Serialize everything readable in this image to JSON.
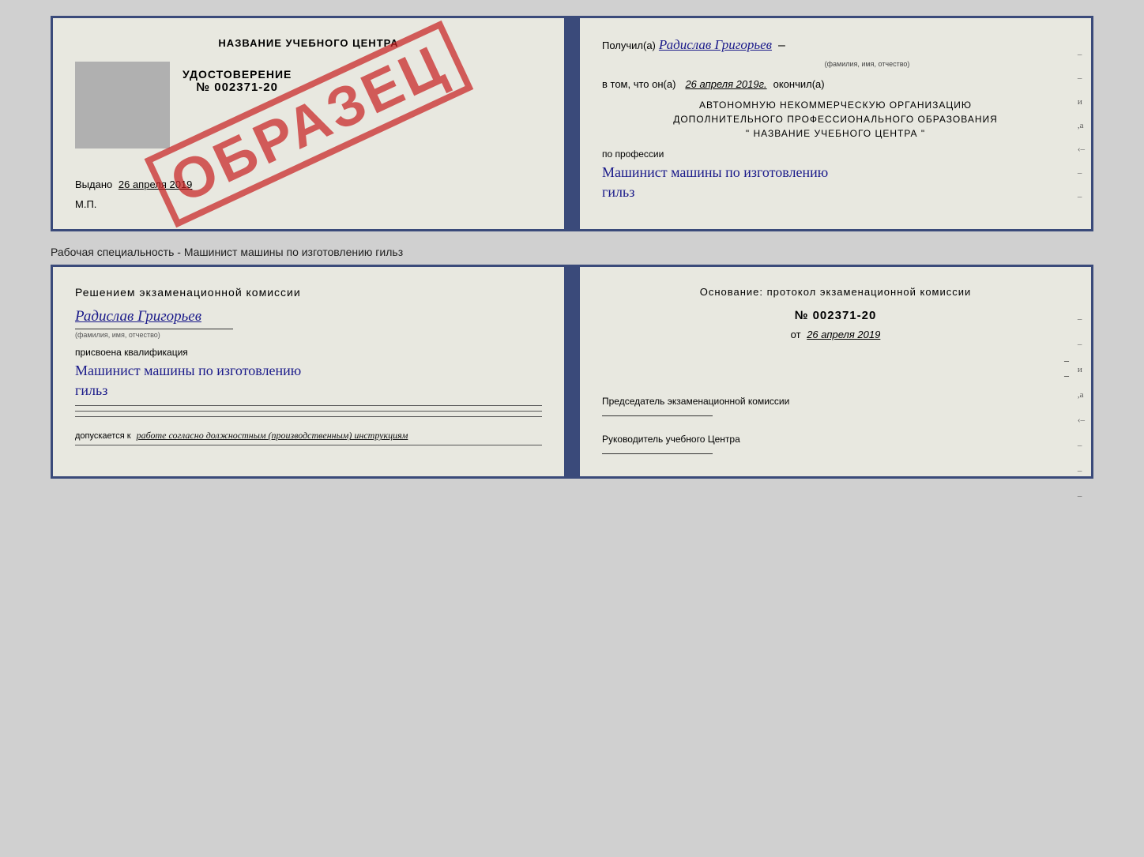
{
  "top_doc": {
    "left": {
      "title": "НАЗВАНИЕ УЧЕБНОГО ЦЕНТРА",
      "stamp": "ОБРАЗЕЦ",
      "udostoverenie_label": "УДОСТОВЕРЕНИЕ",
      "number": "№ 002371-20",
      "vidano_label": "Выдано",
      "vidano_date": "26 апреля 2019",
      "mp_label": "М.П."
    },
    "right": {
      "poluchil_label": "Получил(а)",
      "poluchil_name": "Радислав Григорьев",
      "fio_label": "(фамилия, имя, отчество)",
      "vtom_label": "в том, что он(а)",
      "date_value": "26 апреля 2019г.",
      "okonchil_label": "окончил(а)",
      "org_line1": "АВТОНОМНУЮ НЕКОММЕРЧЕСКУЮ ОРГАНИЗАЦИЮ",
      "org_line2": "ДОПОЛНИТЕЛЬНОГО ПРОФЕССИОНАЛЬНОГО ОБРАЗОВАНИЯ",
      "org_quote": "\"  НАЗВАНИЕ УЧЕБНОГО ЦЕНТРА  \"",
      "po_professii_label": "по профессии",
      "profession_line1": "Машинист машины по изготовлению",
      "profession_line2": "гильз"
    }
  },
  "separator": {
    "text": "Рабочая специальность - Машинист машины по изготовлению гильз"
  },
  "bottom_doc": {
    "left": {
      "title": "Решением  экзаменационной  комиссии",
      "name": "Радислав Григорьев",
      "fio_label": "(фамилия, имя, отчество)",
      "prisvoena_label": "присвоена квалификация",
      "profession_line1": "Машинист машины по изготовлению",
      "profession_line2": "гильз",
      "dopuskaetsya_label": "допускается к",
      "dopuskaetsya_text": "работе согласно должностным (производственным) инструкциям"
    },
    "right": {
      "osnovanie_label": "Основание: протокол экзаменационной  комиссии",
      "number": "№  002371-20",
      "ot_label": "от",
      "ot_date": "26 апреля 2019",
      "predsedatel_label": "Председатель экзаменационной комиссии",
      "rukovoditel_label": "Руководитель учебного Центра"
    }
  }
}
